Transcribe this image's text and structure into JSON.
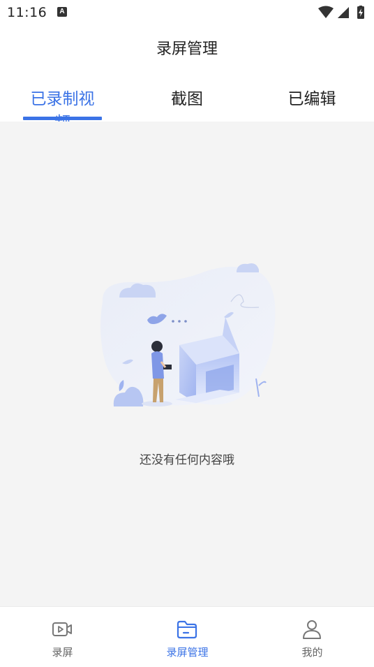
{
  "status_bar": {
    "time": "11:16",
    "notification_icon": "a-icon",
    "right_icons": [
      "wifi-icon",
      "signal-icon",
      "battery-charging-icon"
    ]
  },
  "header": {
    "title": "录屏管理"
  },
  "tabs": [
    {
      "label": "已录制视频",
      "active": true
    },
    {
      "label": "截图",
      "active": false
    },
    {
      "label": "已编辑",
      "active": false
    }
  ],
  "empty_state": {
    "illustration": "empty-box-illustration",
    "message": "还没有任何内容哦"
  },
  "bottom_nav": [
    {
      "label": "录屏",
      "icon": "video-record-icon",
      "active": false
    },
    {
      "label": "录屏管理",
      "icon": "folder-icon",
      "active": true
    },
    {
      "label": "我的",
      "icon": "person-icon",
      "active": false
    }
  ],
  "colors": {
    "accent": "#3b73e6",
    "content_background": "#f4f4f4",
    "inactive_text": "#666666"
  }
}
